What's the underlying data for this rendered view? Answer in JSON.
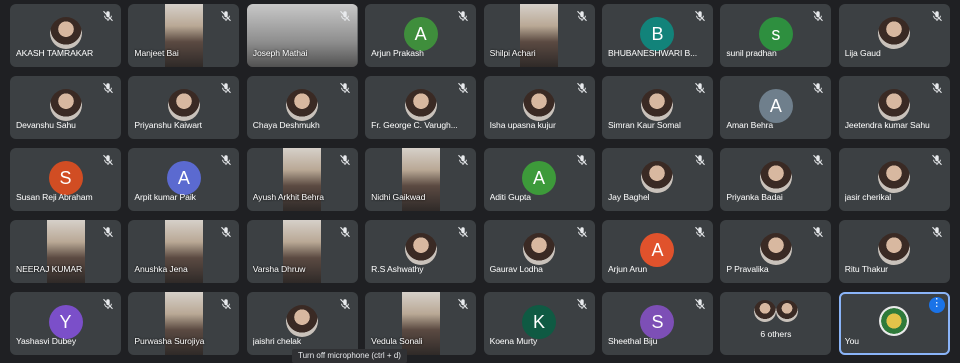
{
  "participants": [
    {
      "name": "AKASH TAMRAKAR",
      "kind": "photo"
    },
    {
      "name": "Manjeet Bai",
      "kind": "video"
    },
    {
      "name": "Joseph Mathai",
      "kind": "video-wide"
    },
    {
      "name": "Arjun Prakash",
      "kind": "letter",
      "initial": "A",
      "color": "#3f8e3c"
    },
    {
      "name": "Shilpi Achari",
      "kind": "video"
    },
    {
      "name": "BHUBANESHWARI B...",
      "kind": "letter",
      "initial": "B",
      "color": "#12837a"
    },
    {
      "name": "sunil pradhan",
      "kind": "letter",
      "initial": "s",
      "color": "#2e8f3f"
    },
    {
      "name": "Lija Gaud",
      "kind": "photo"
    },
    {
      "name": "Devanshu Sahu",
      "kind": "photo"
    },
    {
      "name": "Priyanshu Kaiwart",
      "kind": "photo"
    },
    {
      "name": "Chaya Deshmukh",
      "kind": "photo"
    },
    {
      "name": "Fr. George C. Varugh...",
      "kind": "photo"
    },
    {
      "name": "Isha upasna kujur",
      "kind": "photo"
    },
    {
      "name": "Simran Kaur Somal",
      "kind": "photo"
    },
    {
      "name": "Aman Behra",
      "kind": "letter",
      "initial": "A",
      "color": "#6f7f8c"
    },
    {
      "name": "Jeetendra kumar Sahu",
      "kind": "photo"
    },
    {
      "name": "Susan Reji Abraham",
      "kind": "letter",
      "initial": "S",
      "color": "#d14d23"
    },
    {
      "name": "Arpit kumar Paik",
      "kind": "letter",
      "initial": "A",
      "color": "#5b6ad0"
    },
    {
      "name": "Ayush Arkhit Behra",
      "kind": "video"
    },
    {
      "name": "Nidhi Gaikwad",
      "kind": "video"
    },
    {
      "name": "Aditi Gupta",
      "kind": "letter",
      "initial": "A",
      "color": "#3d9a3a"
    },
    {
      "name": "Jay Baghel",
      "kind": "photo"
    },
    {
      "name": "Priyanka Badai",
      "kind": "photo"
    },
    {
      "name": "jasir cherikal",
      "kind": "photo"
    },
    {
      "name": "NEERAJ KUMAR",
      "kind": "video"
    },
    {
      "name": "Anushka Jena",
      "kind": "video"
    },
    {
      "name": "Varsha Dhruw",
      "kind": "video"
    },
    {
      "name": "R.S Ashwathy",
      "kind": "photo"
    },
    {
      "name": "Gaurav Lodha",
      "kind": "photo"
    },
    {
      "name": "Arjun Arun",
      "kind": "letter",
      "initial": "A",
      "color": "#e0522c"
    },
    {
      "name": "P Pravalika",
      "kind": "photo"
    },
    {
      "name": "Ritu Thakur",
      "kind": "photo"
    },
    {
      "name": "Yashasvi Dubey",
      "kind": "letter",
      "initial": "Y",
      "color": "#7b4fc9"
    },
    {
      "name": "Purwasha Surojiya",
      "kind": "video"
    },
    {
      "name": "jaishri chelak",
      "kind": "photo"
    },
    {
      "name": "Vedula Sonali",
      "kind": "video"
    },
    {
      "name": "Koena Murty",
      "kind": "letter",
      "initial": "K",
      "color": "#0f5a43"
    },
    {
      "name": "Sheethal Biju",
      "kind": "letter",
      "initial": "S",
      "color": "#7d4fb6"
    },
    {
      "name": "6 others",
      "kind": "others"
    },
    {
      "name": "You",
      "kind": "self"
    }
  ],
  "tooltip": "Turn off microphone (ctrl + d)",
  "more_button": "⋮"
}
